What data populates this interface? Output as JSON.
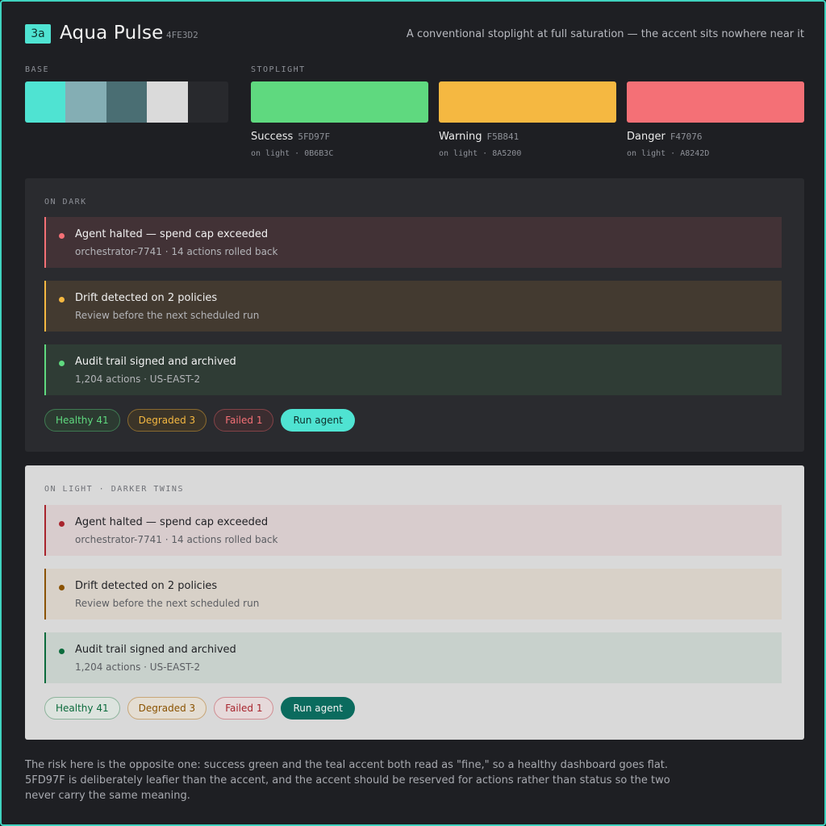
{
  "header": {
    "badge": "3a",
    "title": "Aqua Pulse",
    "hex": "4FE3D2",
    "subtitle": "A conventional stoplight at full saturation — the accent sits nowhere near it"
  },
  "colors": {
    "accent": "#4FE3D2",
    "base": [
      "#4FE3D2",
      "#84AEB4",
      "#4A6E73",
      "#DADADA",
      "#28292D"
    ]
  },
  "base_label": "BASE",
  "stoplight_label": "STOPLIGHT",
  "stoplight": [
    {
      "name": "Success",
      "code": "5FD97F",
      "sub": "on light · 0B6B3C",
      "color": "#5FD97F"
    },
    {
      "name": "Warning",
      "code": "F5B841",
      "sub": "on light · 8A5200",
      "color": "#F5B841"
    },
    {
      "name": "Danger",
      "code": "F47076",
      "sub": "on light · A8242D",
      "color": "#F47076"
    }
  ],
  "dark_panel": {
    "label": "ON DARK",
    "alerts": [
      {
        "title": "Agent halted — spend cap exceeded",
        "sub": "orchestrator-7741 · 14 actions rolled back"
      },
      {
        "title": "Drift detected on 2 policies",
        "sub": "Review before the next scheduled run"
      },
      {
        "title": "Audit trail signed and archived",
        "sub": "1,204 actions · US-EAST-2"
      }
    ],
    "pills": {
      "healthy": "Healthy 41",
      "degraded": "Degraded 3",
      "failed": "Failed 1",
      "run": "Run agent"
    }
  },
  "light_panel": {
    "label": "ON LIGHT · DARKER TWINS",
    "alerts": [
      {
        "title": "Agent halted — spend cap exceeded",
        "sub": "orchestrator-7741 · 14 actions rolled back"
      },
      {
        "title": "Drift detected on 2 policies",
        "sub": "Review before the next scheduled run"
      },
      {
        "title": "Audit trail signed and archived",
        "sub": "1,204 actions · US-EAST-2"
      }
    ],
    "pills": {
      "healthy": "Healthy 41",
      "degraded": "Degraded 3",
      "failed": "Failed 1",
      "run": "Run agent"
    }
  },
  "footer": "The risk here is the opposite one: success green and the teal accent both read as \"fine,\" so a healthy dashboard goes flat. 5FD97F is deliberately leafier than the accent, and the accent should be reserved for actions rather than status so the two never carry the same meaning."
}
